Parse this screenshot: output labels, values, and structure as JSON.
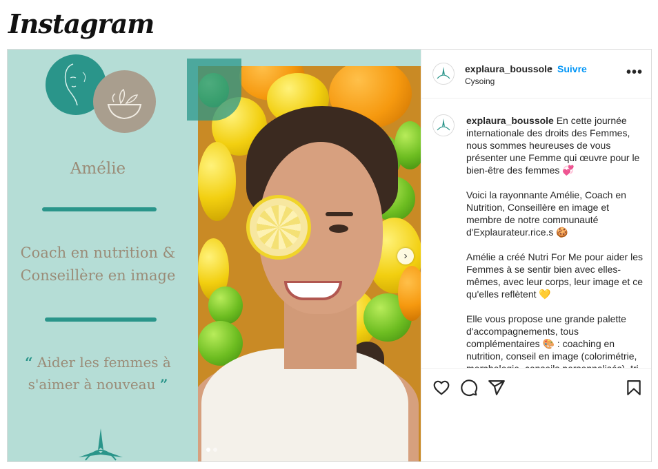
{
  "brand": {
    "logo_text": "Instagram"
  },
  "poster": {
    "name": "Amélie",
    "role_line1": "Coach en nutrition &",
    "role_line2": "Conseillère en image",
    "quote_open": "“",
    "quote_line1": "Aider les femmes à",
    "quote_line2": "s'aimer à nouveau",
    "quote_close": "”"
  },
  "carousel": {
    "next_icon": "chevron-right-icon",
    "slide_count": 2,
    "active_slide": 1
  },
  "header": {
    "username": "explaura_boussole",
    "separator": "•",
    "follow_label": "Suivre",
    "location": "Cysoing",
    "more_icon": "more-horizontal-icon",
    "more_label": "•••"
  },
  "caption": {
    "username": "explaura_boussole",
    "p1": " En cette journée internationale des droits des Femmes, nous sommes heureuses de vous présenter une Femme qui œuvre pour le bien-être des femmes 💞",
    "p2": "Voici la rayonnante Amélie, Coach en Nutrition, Conseillère en image et membre de notre communauté d'Explaurateur.rice.s 🍪",
    "p3": "Amélie a créé Nutri For Me pour aider les Femmes à se sentir bien avec elles-mêmes, avec leur corps, leur image et ce qu'elles reflètent 💛",
    "p4": "Elle vous propose une grande palette d'accompagnements, tous complémentaires 🎨 : coaching en nutrition, conseil en image (colorimétrie, morphologie, conseils personnalisés), tri"
  },
  "actions": {
    "like_icon": "heart-icon",
    "comment_icon": "comment-icon",
    "share_icon": "send-icon",
    "save_icon": "bookmark-icon"
  },
  "colors": {
    "accent_teal": "#2a958a",
    "poster_bg": "#b5ddd6",
    "poster_text": "#9a8c78",
    "link_blue": "#0095f6"
  }
}
